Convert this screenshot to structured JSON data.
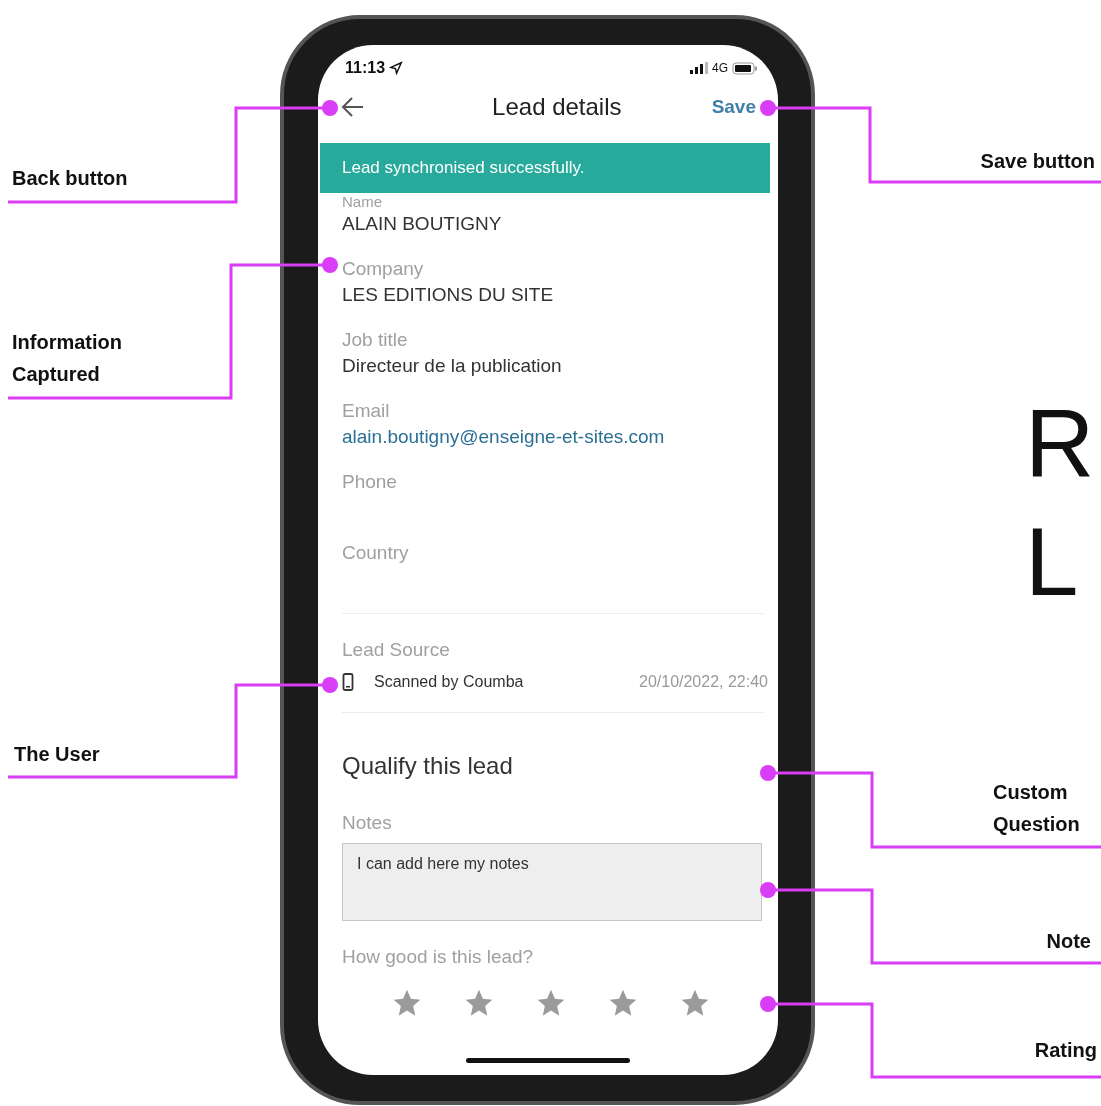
{
  "status_bar": {
    "time": "11:13",
    "network": "4G"
  },
  "nav": {
    "title": "Lead details",
    "save": "Save"
  },
  "banner": "Lead synchronised successfully.",
  "fields": [
    {
      "label": "Name",
      "value": "ALAIN BOUTIGNY",
      "kind": "text"
    },
    {
      "label": "Company",
      "value": "LES EDITIONS DU SITE",
      "kind": "text"
    },
    {
      "label": "Job title",
      "value": "Directeur de la publication",
      "kind": "text"
    },
    {
      "label": "Email",
      "value": "alain.boutigny@enseigne-et-sites.com",
      "kind": "link"
    },
    {
      "label": "Phone"
    },
    {
      "label": "Country"
    }
  ],
  "lead_source": {
    "label": "Lead Source",
    "text": "Scanned by Coumba",
    "date": "20/10/2022, 22:40"
  },
  "qualify": {
    "title": "Qualify this lead",
    "notes_label": "Notes",
    "notes_value": "I can add here my notes",
    "rating_label": "How good is this lead?"
  },
  "annotations": [
    {
      "label": "Back button"
    },
    {
      "label": "Save button"
    },
    {
      "label": "Information Captured"
    },
    {
      "label": "The User"
    },
    {
      "label": "Custom Question"
    },
    {
      "label": "Note"
    },
    {
      "label": "Rating"
    }
  ],
  "side_text": [
    "R",
    "L"
  ]
}
